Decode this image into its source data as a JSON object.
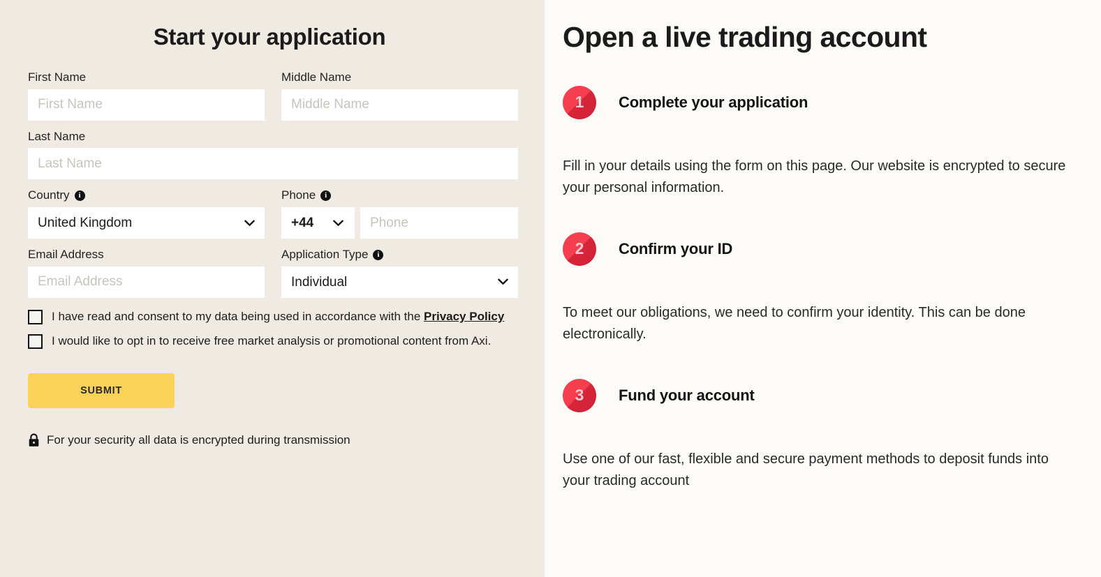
{
  "form": {
    "title": "Start your application",
    "fields": {
      "first_name": {
        "label": "First Name",
        "placeholder": "First Name",
        "value": ""
      },
      "middle_name": {
        "label": "Middle Name",
        "placeholder": "Middle Name",
        "value": ""
      },
      "last_name": {
        "label": "Last Name",
        "placeholder": "Last Name",
        "value": ""
      },
      "country": {
        "label": "Country",
        "value": "United Kingdom",
        "info_icon": "info-icon"
      },
      "phone": {
        "label": "Phone",
        "code_value": "+44",
        "placeholder": "Phone",
        "value": "",
        "info_icon": "info-icon"
      },
      "email": {
        "label": "Email Address",
        "placeholder": "Email Address",
        "value": ""
      },
      "application_type": {
        "label": "Application Type",
        "value": "Individual",
        "info_icon": "info-icon"
      }
    },
    "consents": [
      {
        "text": "I have read and consent to my data being used in accordance with the ",
        "link_text": "Privacy Policy",
        "checked": false
      },
      {
        "text": "I would like to opt in to receive free market analysis or promotional content from Axi.",
        "link_text": "",
        "checked": false
      }
    ],
    "submit_label": "SUBMIT",
    "security_note": "For your security all data is encrypted during transmission",
    "security_icon": "lock-icon",
    "chevron_icon": "chevron-down-icon"
  },
  "info": {
    "title": "Open a live trading account",
    "steps": [
      {
        "number": "1",
        "title": "Complete your application",
        "body": "Fill in your details using the form on this page. Our website is encrypted to secure your personal information."
      },
      {
        "number": "2",
        "title": "Confirm your ID",
        "body": "To meet our obligations, we need to confirm your identity. This can be done electronically."
      },
      {
        "number": "3",
        "title": "Fund your account",
        "body": "Use one of our fast, flexible and secure payment methods to deposit funds into your trading account"
      }
    ]
  },
  "colors": {
    "panel_bg": "#EFEAE2",
    "page_bg": "#FCFBF8",
    "submit": "#F9D257",
    "badge_red": "#F53F4F",
    "badge_red_dark": "#D2203A",
    "badge_number": "#FBC9CE",
    "text": "#1B1B1B"
  }
}
